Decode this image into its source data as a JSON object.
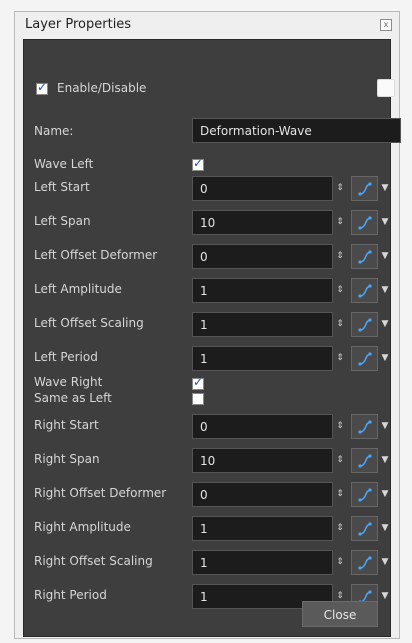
{
  "window": {
    "title": "Layer Properties"
  },
  "enable": {
    "label": "Enable/Disable",
    "checked": true
  },
  "name": {
    "label": "Name:",
    "value": "Deformation-Wave"
  },
  "wave_left": {
    "label": "Wave Left",
    "checked": true
  },
  "left_fields": [
    {
      "label": "Left Start",
      "value": "0"
    },
    {
      "label": "Left Span",
      "value": "10"
    },
    {
      "label": "Left Offset Deformer",
      "value": "0"
    },
    {
      "label": "Left Amplitude",
      "value": "1"
    },
    {
      "label": "Left Offset Scaling",
      "value": "1"
    },
    {
      "label": "Left Period",
      "value": "1"
    }
  ],
  "wave_right": {
    "label": "Wave Right",
    "checked": true
  },
  "same_as_left": {
    "label": "Same as Left",
    "checked": false
  },
  "right_fields": [
    {
      "label": "Right Start",
      "value": "0"
    },
    {
      "label": "Right Span",
      "value": "10"
    },
    {
      "label": "Right Offset Deformer",
      "value": "0"
    },
    {
      "label": "Right Amplitude",
      "value": "1"
    },
    {
      "label": "Right Offset Scaling",
      "value": "1"
    },
    {
      "label": "Right Period",
      "value": "1"
    }
  ],
  "buttons": {
    "close": "Close"
  }
}
